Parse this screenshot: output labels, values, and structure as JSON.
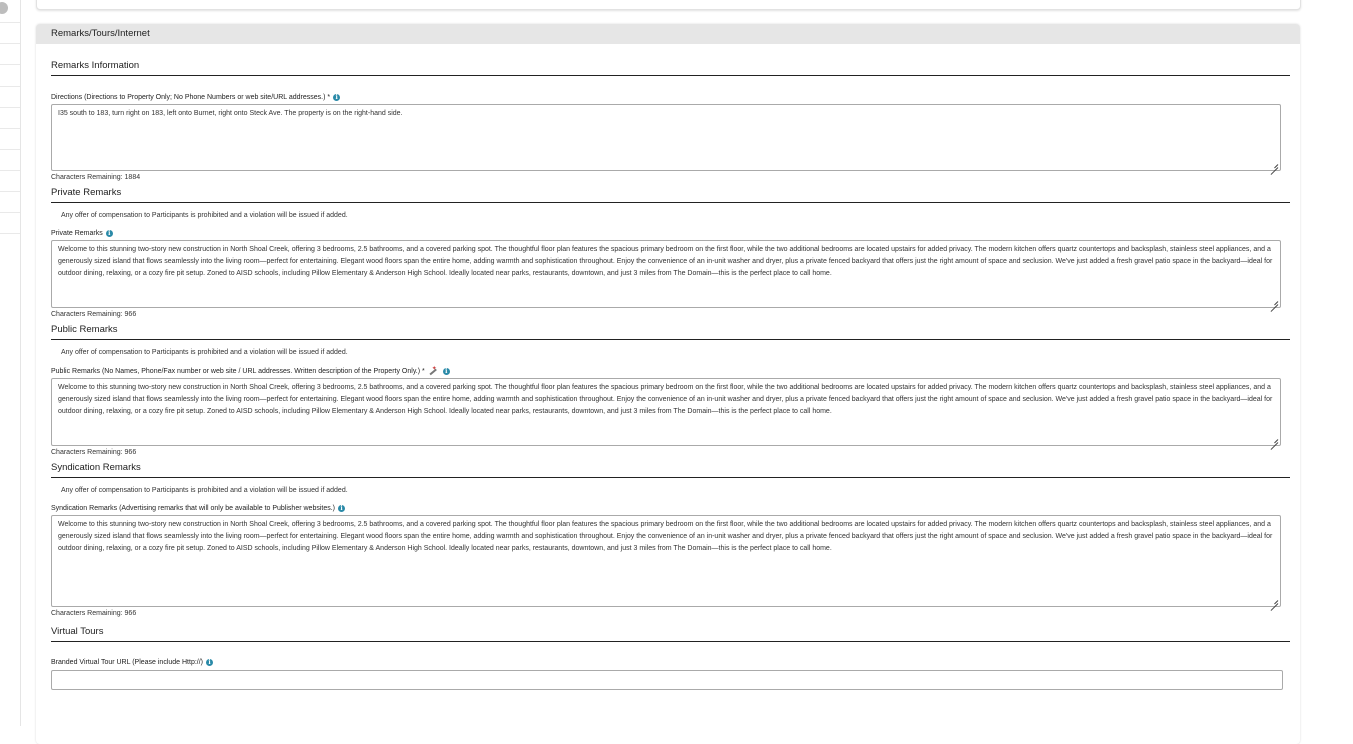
{
  "panel": {
    "title": "Remarks/Tours/Internet"
  },
  "sections": {
    "remarks_info": {
      "title": "Remarks Information",
      "directions_label": "Directions (Directions to Property Only; No Phone Numbers or web site/URL addresses.) *",
      "directions_value": "I35 south to 183, turn right on 183, left onto Burnet, right onto Steck Ave. The property is on the right-hand side.",
      "directions_chars": "Characters Remaining: 1884"
    },
    "private": {
      "title": "Private Remarks",
      "notice": "Any offer of compensation to Participants is prohibited and a violation will be issued if added.",
      "label": "Private Remarks",
      "value": "Welcome to this stunning two-story new construction in North Shoal Creek, offering 3 bedrooms, 2.5 bathrooms, and a covered parking spot. The thoughtful floor plan features the spacious primary bedroom on the first floor, while the two additional bedrooms are located upstairs for added privacy. The modern kitchen offers quartz countertops and backsplash, stainless steel appliances, and a generously sized island that flows seamlessly into the living room—perfect for entertaining. Elegant wood floors span the entire home, adding warmth and sophistication throughout. Enjoy the convenience of an in-unit washer and dryer, plus a private fenced backyard that offers just the right amount of space and seclusion. We've just added a fresh gravel patio space in the backyard—ideal for outdoor dining, relaxing, or a cozy fire pit setup. Zoned to AISD schools, including Pillow Elementary & Anderson High School. Ideally located near parks, restaurants, downtown, and just 3 miles from The Domain—this is the perfect place to call home.",
      "chars": "Characters Remaining: 966"
    },
    "public": {
      "title": "Public Remarks",
      "notice": "Any offer of compensation to Participants is prohibited and a violation will be issued if added.",
      "label": "Public Remarks (No Names, Phone/Fax number or web site / URL addresses. Written description of the Property Only.) *",
      "value": "Welcome to this stunning two-story new construction in North Shoal Creek, offering 3 bedrooms, 2.5 bathrooms, and a covered parking spot. The thoughtful floor plan features the spacious primary bedroom on the first floor, while the two additional bedrooms are located upstairs for added privacy. The modern kitchen offers quartz countertops and backsplash, stainless steel appliances, and a generously sized island that flows seamlessly into the living room—perfect for entertaining. Elegant wood floors span the entire home, adding warmth and sophistication throughout. Enjoy the convenience of an in-unit washer and dryer, plus a private fenced backyard that offers just the right amount of space and seclusion. We've just added a fresh gravel patio space in the backyard—ideal for outdoor dining, relaxing, or a cozy fire pit setup. Zoned to AISD schools, including Pillow Elementary & Anderson High School. Ideally located near parks, restaurants, downtown, and just 3 miles from The Domain—this is the perfect place to call home.",
      "chars": "Characters Remaining: 966"
    },
    "syndication": {
      "title": "Syndication Remarks",
      "notice": "Any offer of compensation to Participants is prohibited and a violation will be issued if added.",
      "label": "Syndication Remarks (Advertising remarks that will only be available to Publisher websites.)",
      "value": "Welcome to this stunning two-story new construction in North Shoal Creek, offering 3 bedrooms, 2.5 bathrooms, and a covered parking spot. The thoughtful floor plan features the spacious primary bedroom on the first floor, while the two additional bedrooms are located upstairs for added privacy. The modern kitchen offers quartz countertops and backsplash, stainless steel appliances, and a generously sized island that flows seamlessly into the living room—perfect for entertaining. Elegant wood floors span the entire home, adding warmth and sophistication throughout. Enjoy the convenience of an in-unit washer and dryer, plus a private fenced backyard that offers just the right amount of space and seclusion. We've just added a fresh gravel patio space in the backyard—ideal for outdoor dining, relaxing, or a cozy fire pit setup. Zoned to AISD schools, including Pillow Elementary & Anderson High School. Ideally located near parks, restaurants, downtown, and just 3 miles from The Domain—this is the perfect place to call home.",
      "chars": "Characters Remaining: 966"
    },
    "tours": {
      "title": "Virtual Tours",
      "branded_label": "Branded Virtual Tour URL (Please include Http://)",
      "branded_value": ""
    }
  },
  "icons": {
    "info": "info-icon",
    "wand": "magic-wand-icon"
  },
  "colors": {
    "info_icon": "#2a8aa8",
    "header_bg": "#e6e6e6",
    "divider": "#222222"
  }
}
